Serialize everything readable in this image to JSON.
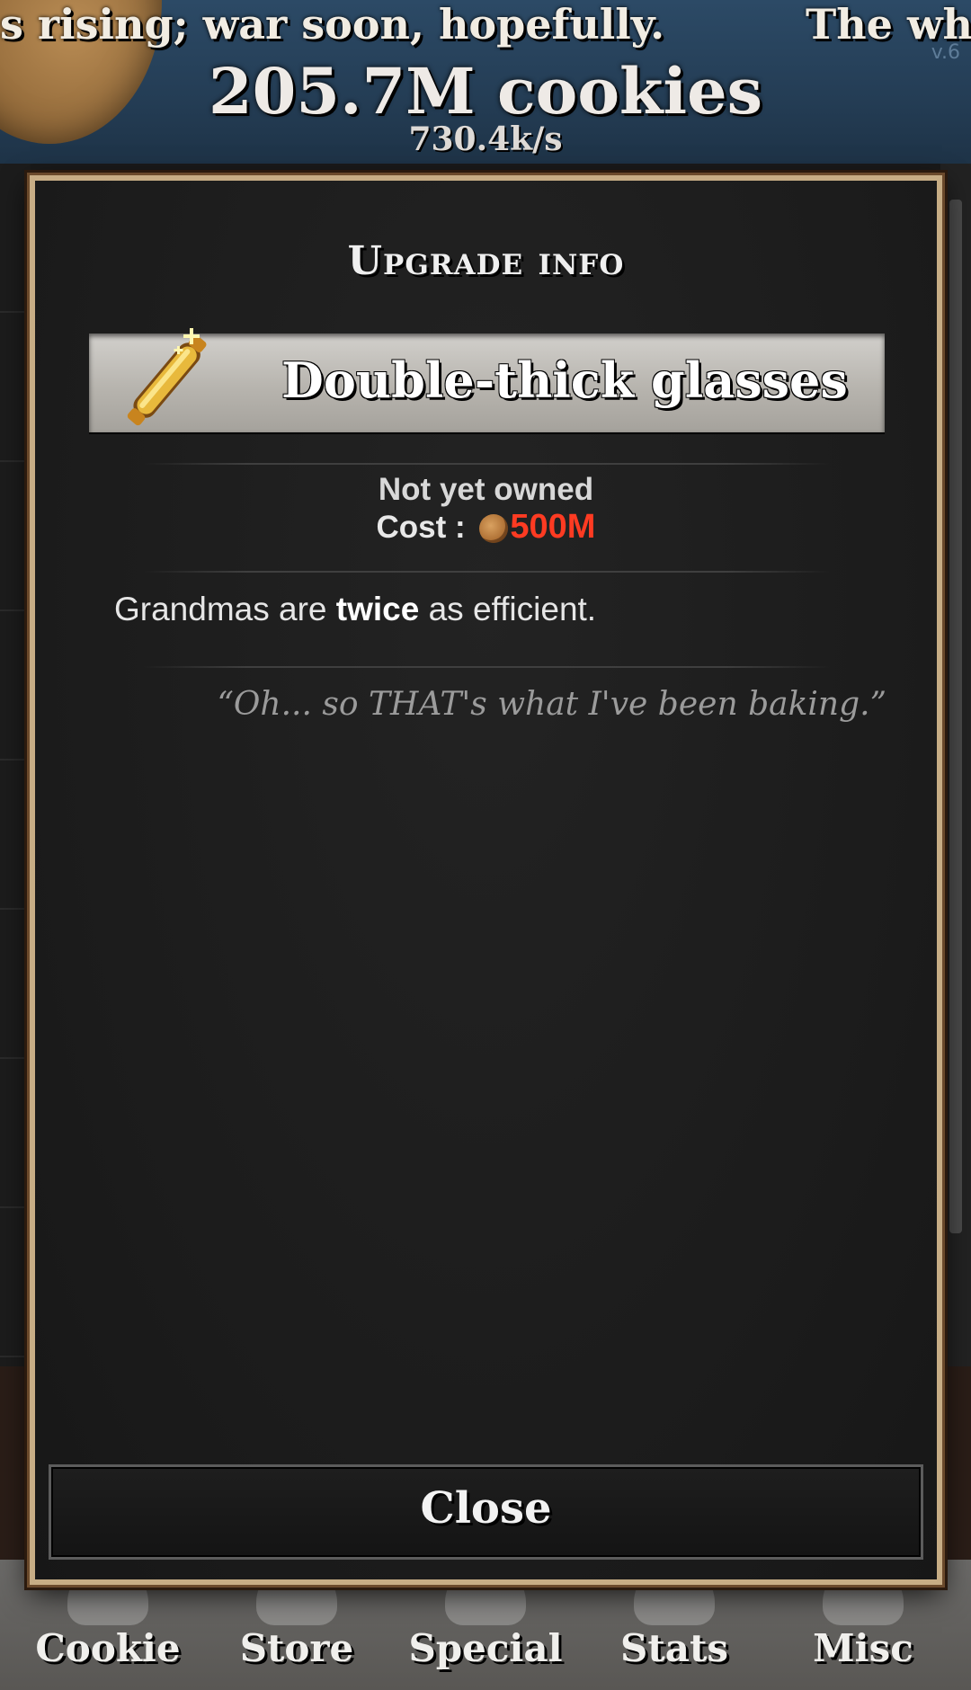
{
  "header": {
    "ticker_left": "s rising; war soon, hopefully.",
    "ticker_right": "The wh",
    "version": "v.6",
    "cookie_count": "205.7M cookies",
    "cookie_rate": "730.4k/s"
  },
  "modal": {
    "title": "Upgrade info",
    "upgrade_name": "Double-thick glasses",
    "upgrade_icon": "rolling-pin-sparkle-icon",
    "owned_status": "Not yet owned",
    "cost_label": "Cost :",
    "cost_value": "500M",
    "cost_icon": "cookie-icon",
    "description": {
      "prefix": "Grandmas are ",
      "emphasis": "twice",
      "suffix": " as efficient."
    },
    "quote": "“Oh... so THAT's what I've been baking.”",
    "close_label": "Close"
  },
  "nav": {
    "items": [
      {
        "label": "Cookie",
        "icon": "cookie-icon"
      },
      {
        "label": "Store",
        "icon": "store-icon"
      },
      {
        "label": "Special",
        "icon": "special-icon"
      },
      {
        "label": "Stats",
        "icon": "stats-icon"
      },
      {
        "label": "Misc",
        "icon": "misc-icon"
      }
    ]
  },
  "colors": {
    "cost_red": "#ff3b22",
    "modal_border": "#c7ad85",
    "header_blue": "#2c4a66"
  }
}
